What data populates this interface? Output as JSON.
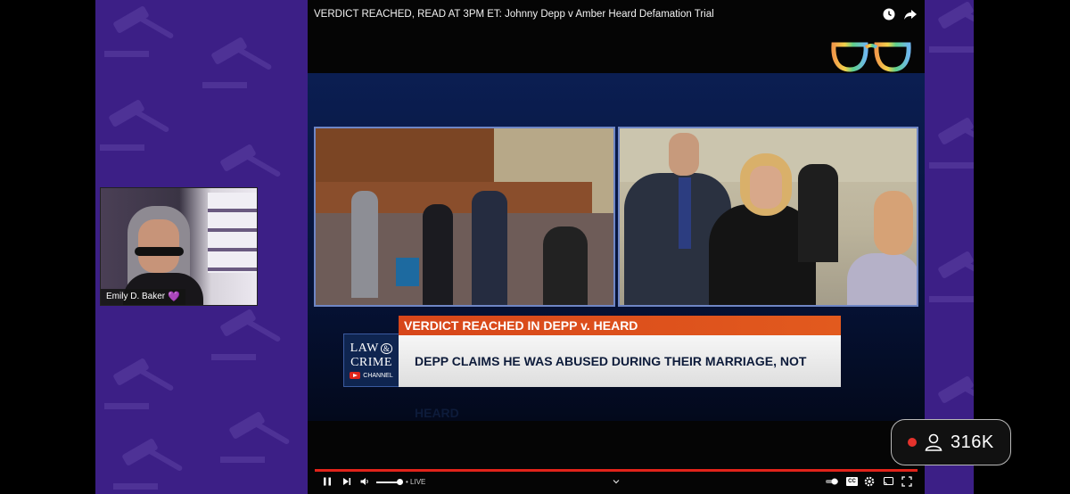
{
  "video": {
    "title": "VERDICT REACHED, READ AT 3PM ET: Johnny Depp v Amber Heard Defamation Trial"
  },
  "broadcast": {
    "headline": "VERDICT REACHED IN DEPP v. HEARD",
    "subheadline": "DEPP CLAIMS HE WAS ABUSED DURING THEIR MARRIAGE, NOT HEARD",
    "logo_line1": "LAW",
    "logo_amp": "&",
    "logo_line2": "CRIME",
    "logo_channel": "CHANNEL"
  },
  "controls": {
    "live_label": "• LIVE",
    "cc_label": "CC"
  },
  "webcam": {
    "name": "Emily D. Baker",
    "heart": "💜"
  },
  "stream": {
    "viewer_count": "316K"
  },
  "colors": {
    "background_purple": "#3c1f86",
    "progress_red": "#e2231a",
    "headline_orange": "#d7461a",
    "live_dot": "#e5322c"
  }
}
